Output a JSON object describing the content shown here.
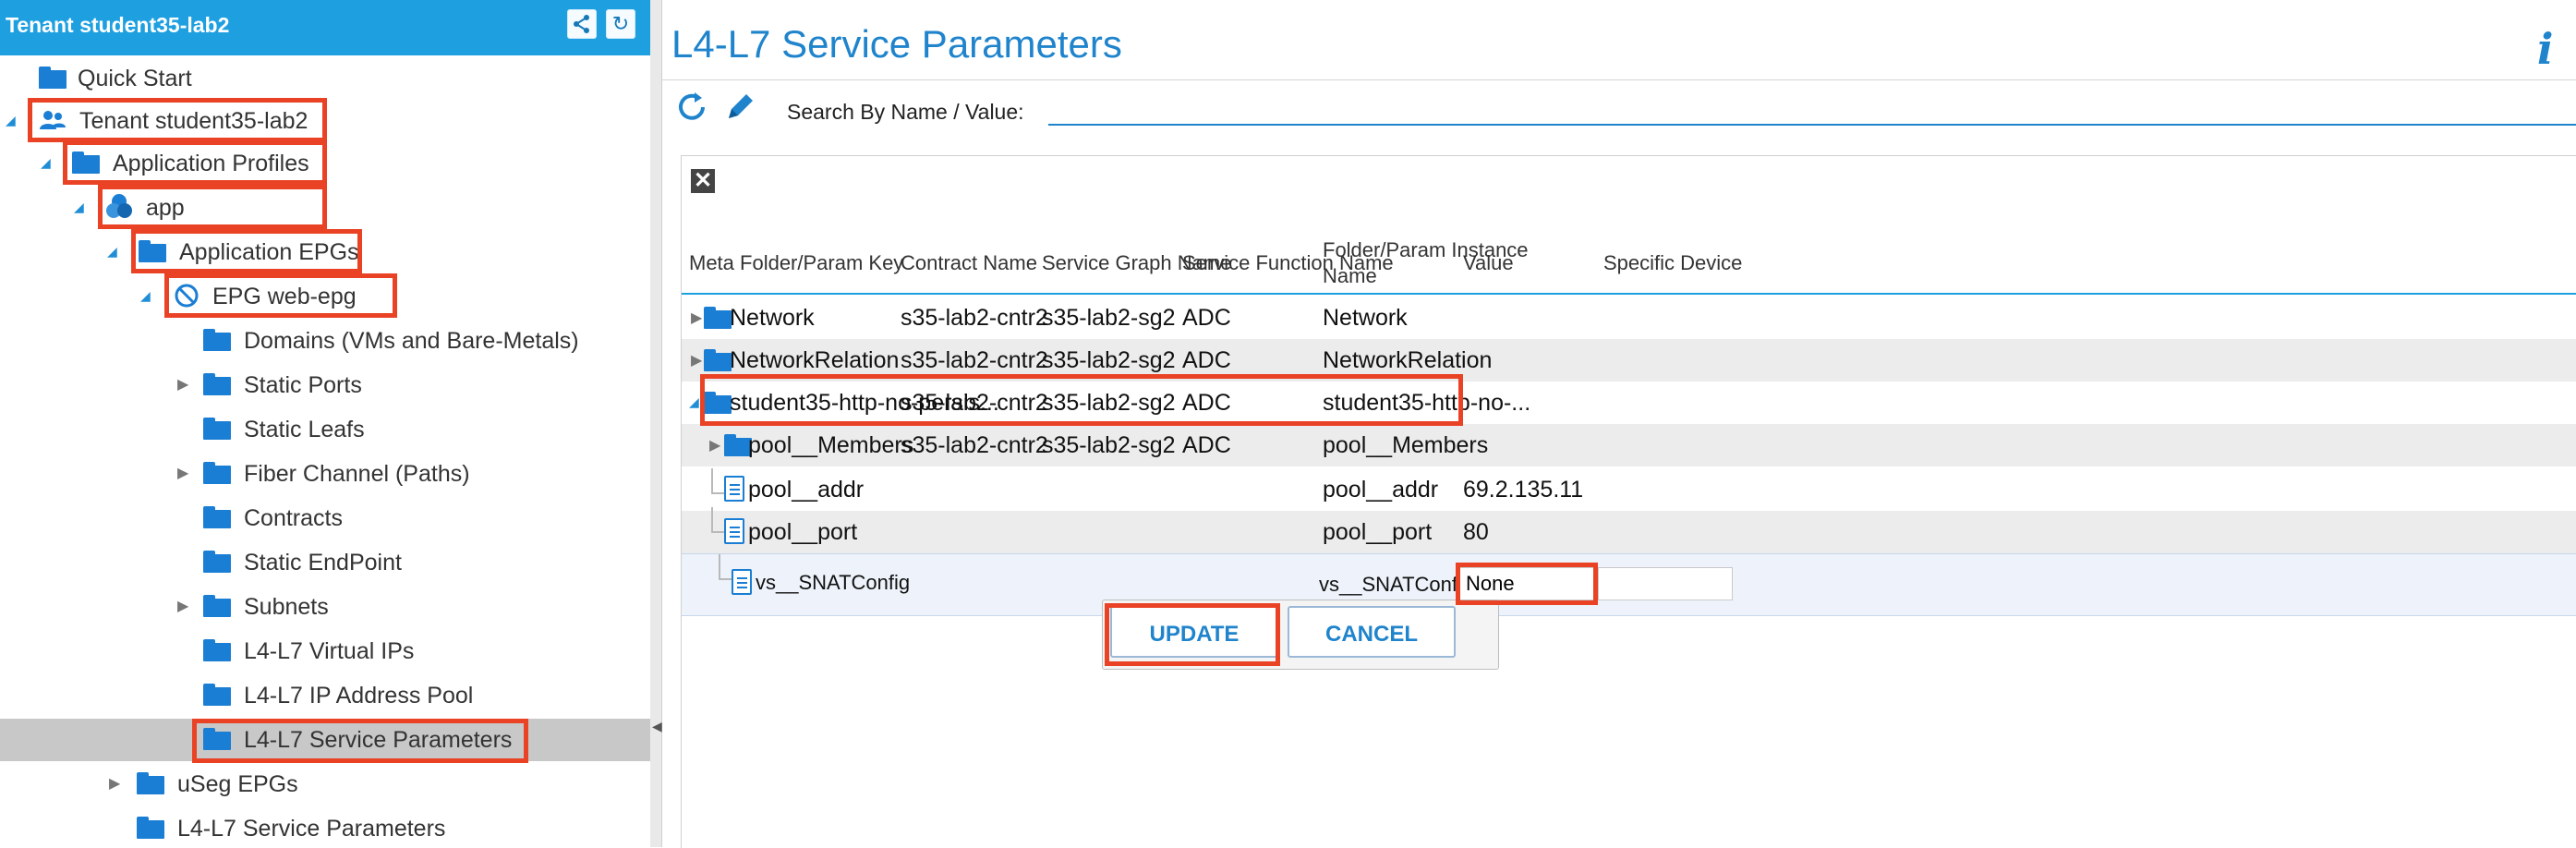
{
  "tenant_header": {
    "title": "Tenant student35-lab2"
  },
  "tree": {
    "quick_start": "Quick Start",
    "tenant": "Tenant student35-lab2",
    "app_profiles": "Application Profiles",
    "app": "app",
    "app_epgs": "Application EPGs",
    "epg": "EPG web-epg",
    "domains": "Domains (VMs and Bare-Metals)",
    "static_ports": "Static Ports",
    "static_leafs": "Static Leafs",
    "fiber_channel": "Fiber Channel (Paths)",
    "contracts": "Contracts",
    "static_endpoint": "Static EndPoint",
    "subnets": "Subnets",
    "vips": "L4-L7 Virtual IPs",
    "ip_pool": "L4-L7 IP Address Pool",
    "service_params_child": "L4-L7 Service Parameters",
    "useg_epgs": "uSeg EPGs",
    "service_params": "L4-L7 Service Parameters"
  },
  "page": {
    "title": "L4-L7 Service Parameters"
  },
  "toolbar": {
    "search_label": "Search By Name / Value:",
    "search_value": ""
  },
  "table": {
    "columns": [
      "Meta Folder/Param Key",
      "Contract Name",
      "Service Graph Name",
      "Service Function Name",
      "Folder/Param Instance",
      "Name",
      "Value",
      "Specific Device"
    ],
    "rows": [
      {
        "key": "Network",
        "contract": "s35-lab2-cntr2",
        "graph": "s35-lab2-sg2",
        "func": "ADC",
        "instance": "Network",
        "value": ""
      },
      {
        "key": "NetworkRelation",
        "contract": "s35-lab2-cntr2",
        "graph": "s35-lab2-sg2",
        "func": "ADC",
        "instance": "NetworkRelation",
        "value": ""
      },
      {
        "key": "student35-http-no-persis...",
        "contract": "s35-lab2-cntr2",
        "graph": "s35-lab2-sg2",
        "func": "ADC",
        "instance": "student35-http-no-...",
        "value": ""
      },
      {
        "key": "pool__Members",
        "contract": "s35-lab2-cntr2",
        "graph": "s35-lab2-sg2",
        "func": "ADC",
        "instance": "pool__Members",
        "value": ""
      },
      {
        "key": "pool__addr",
        "contract": "",
        "graph": "",
        "func": "",
        "instance": "pool__addr",
        "value": "69.2.135.11"
      },
      {
        "key": "pool__port",
        "contract": "",
        "graph": "",
        "func": "",
        "instance": "pool__port",
        "value": "80"
      },
      {
        "key": "vs__SNATConfig",
        "contract": "",
        "graph": "",
        "func": "",
        "instance": "vs__SNATConfig",
        "value": "None",
        "device": ""
      }
    ]
  },
  "buttons": {
    "update": "UPDATE",
    "cancel": "CANCEL"
  },
  "icons": [
    "tree-icon",
    "refresh-icon",
    "edit-icon",
    "close-icon",
    "info-icon",
    "folder-icon",
    "param-doc-icon",
    "tenant-icon",
    "app-icon",
    "epg-icon"
  ],
  "colors": {
    "header_blue": "#1ea0e0",
    "title_blue": "#1f84cc",
    "folder_blue": "#1a7ed4",
    "highlight_red": "#e94225",
    "selected_gray": "#c8c8c8"
  }
}
